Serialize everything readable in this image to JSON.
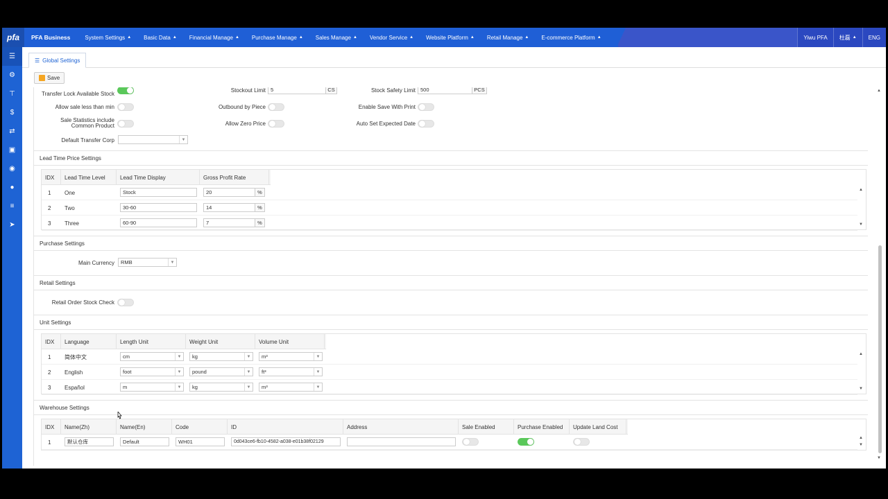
{
  "topnav": {
    "logo": "pfa",
    "brand": "PFA Business",
    "menu": [
      "System Settings",
      "Basic Data",
      "Financial Manage",
      "Purchase Manage",
      "Sales Manage",
      "Vendor Service",
      "Website Platform",
      "Retail Manage",
      "E-commerce Platform"
    ],
    "user_area": "Yiwu PFA",
    "user_name": "杜磊",
    "language": "ENG"
  },
  "tab": {
    "label": "Global Settings"
  },
  "toolbar": {
    "save_label": "Save"
  },
  "general": {
    "transfer_lock_label": "Transfer Lock Available Stock",
    "transfer_lock_on": true,
    "allow_sale_less_label": "Allow sale less than min",
    "sale_stats_label": "Sale Statistics include Common Product",
    "default_transfer_corp_label": "Default Transfer Corp",
    "default_transfer_corp_value": "",
    "stockout_limit_label": "Stockout Limit",
    "stockout_limit_value": "5",
    "stockout_limit_unit": "CS",
    "outbound_by_piece_label": "Outbound by Piece",
    "allow_zero_price_label": "Allow Zero Price",
    "stock_safety_limit_label": "Stock Safety Limit",
    "stock_safety_limit_value": "500",
    "stock_safety_limit_unit": "PCS",
    "enable_save_print_label": "Enable Save With Print",
    "auto_set_expected_date_label": "Auto Set Expected Date"
  },
  "lead_time": {
    "title": "Lead Time Price Settings",
    "headers": [
      "IDX",
      "Lead Time Level",
      "Lead Time Display",
      "Gross Profit Rate"
    ],
    "rows": [
      {
        "idx": "1",
        "level": "One",
        "display": "Stock",
        "rate": "20",
        "unit": "%"
      },
      {
        "idx": "2",
        "level": "Two",
        "display": "30-60",
        "rate": "14",
        "unit": "%"
      },
      {
        "idx": "3",
        "level": "Three",
        "display": "60-90",
        "rate": "7",
        "unit": "%"
      }
    ]
  },
  "purchase": {
    "title": "Purchase Settings",
    "main_currency_label": "Main Currency",
    "main_currency_value": "RMB"
  },
  "retail": {
    "title": "Retail Settings",
    "stock_check_label": "Retail Order Stock Check"
  },
  "unit": {
    "title": "Unit Settings",
    "headers": [
      "IDX",
      "Language",
      "Length Unit",
      "Weight Unit",
      "Volume Unit"
    ],
    "rows": [
      {
        "idx": "1",
        "language": "简体中文",
        "length": "cm",
        "weight": "kg",
        "volume": "m³"
      },
      {
        "idx": "2",
        "language": "English",
        "length": "foot",
        "weight": "pound",
        "volume": "ft³"
      },
      {
        "idx": "3",
        "language": "Español",
        "length": "m",
        "weight": "kg",
        "volume": "m³"
      }
    ]
  },
  "warehouse": {
    "title": "Warehouse Settings",
    "headers": [
      "IDX",
      "Name(Zh)",
      "Name(En)",
      "Code",
      "ID",
      "Address",
      "Sale Enabled",
      "Purchase Enabled",
      "Update Land Cost"
    ],
    "rows": [
      {
        "idx": "1",
        "name_zh": "默认仓库",
        "name_en": "Default",
        "code": "WH01",
        "id": "0d043ce6-fb10-4582-a038-e01b38f02129",
        "address": "",
        "sale_enabled": false,
        "purchase_enabled": true,
        "update_land_cost": false
      }
    ]
  },
  "icons": {
    "sidenav": [
      "list-icon",
      "gear-icon",
      "sitemap-icon",
      "dollar-icon",
      "refresh-icon",
      "money-icon",
      "user-circle-icon",
      "globe-icon",
      "bars-icon",
      "send-icon"
    ]
  }
}
